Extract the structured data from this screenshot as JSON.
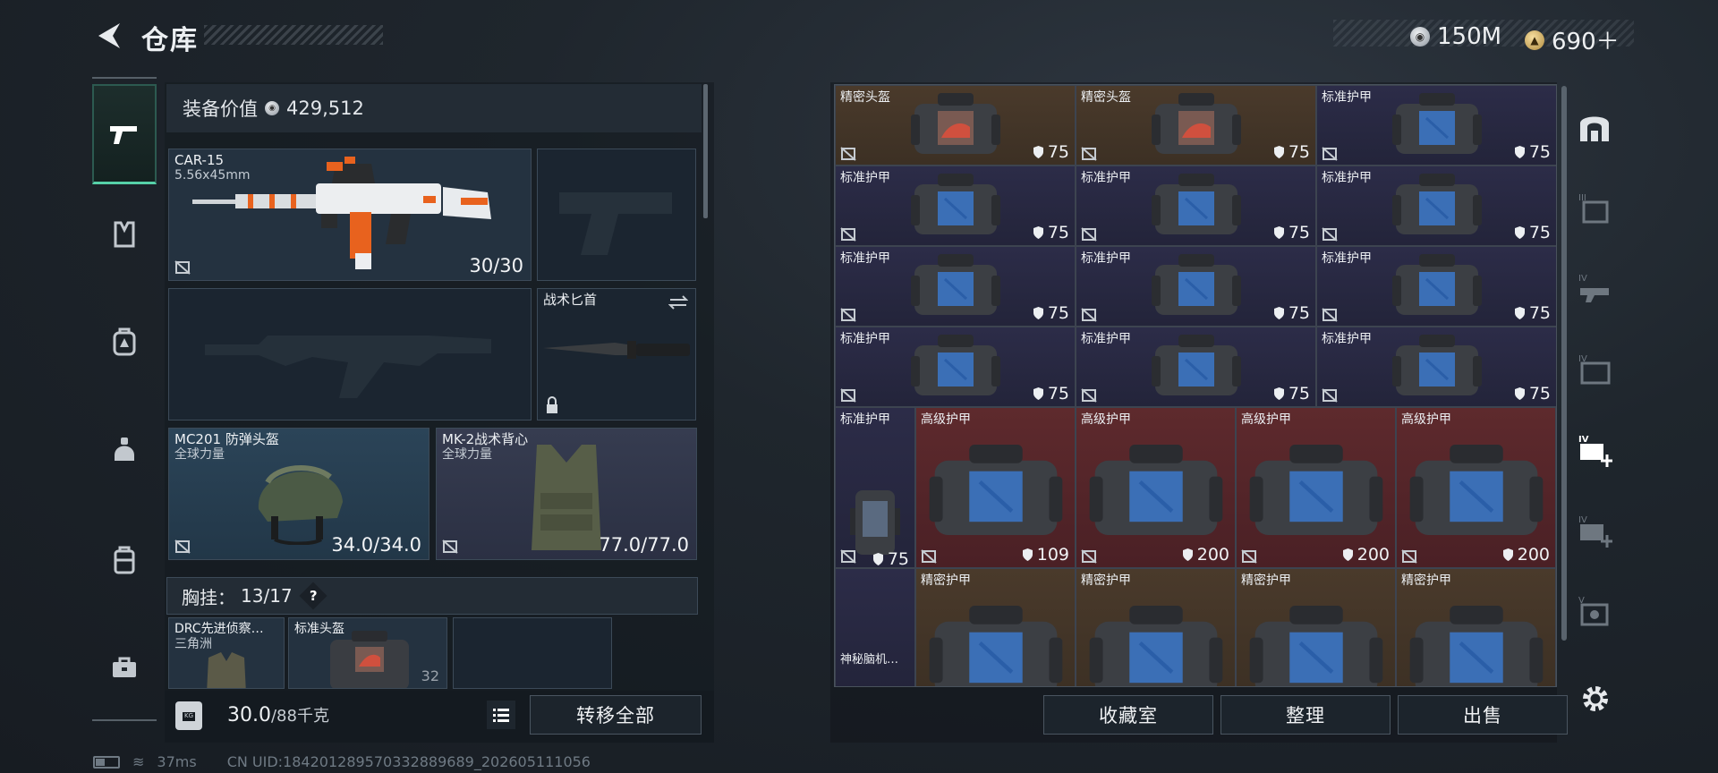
{
  "header": {
    "title": "仓库",
    "currency": [
      {
        "icon": "silver-coin-icon",
        "value": "150M"
      },
      {
        "icon": "gold-coin-icon",
        "value": "690＋"
      }
    ]
  },
  "left_nav": {
    "items": [
      "pistol-icon",
      "armor-vest-icon",
      "backpack-icon",
      "helmet-icon",
      "chest-rig-icon",
      "toolbox-icon"
    ],
    "active": 0
  },
  "equipment": {
    "value_label": "装备价值",
    "value": "429,512",
    "primary": {
      "name": "CAR-15",
      "caliber": "5.56x45mm",
      "ammo": "30/30"
    },
    "melee": {
      "name": "战术匕首"
    },
    "helmet": {
      "name": "MC201 防弹头盔",
      "sub": "全球力量",
      "durability": "34.0/34.0"
    },
    "vest": {
      "name": "MK-2战术背心",
      "sub": "全球力量",
      "durability": "77.0/77.0"
    },
    "chest_rig": {
      "label": "胸挂：",
      "capacity": "13/17",
      "help": "?"
    },
    "rig_items": [
      {
        "name": "DRC先进侦察…",
        "sub": "三角洲"
      },
      {
        "name": "标准头盔",
        "val": "32"
      }
    ]
  },
  "bottom_left": {
    "weight": "30.0",
    "weight_max": "/88千克",
    "transfer_all": "转移全部"
  },
  "status_bar": {
    "ping": "37ms",
    "uid": "CN UID:1842012895703328896​89_202605111056"
  },
  "stash": {
    "rows": [
      [
        {
          "name": "精密头盔",
          "val": "75",
          "color": "gold"
        },
        {
          "name": "精密头盔",
          "val": "75",
          "color": "gold"
        },
        {
          "name": "标准护甲",
          "val": "75",
          "color": "blue"
        }
      ],
      [
        {
          "name": "标准护甲",
          "val": "75",
          "color": "blue"
        },
        {
          "name": "标准护甲",
          "val": "75",
          "color": "blue"
        },
        {
          "name": "标准护甲",
          "val": "75",
          "color": "blue"
        }
      ],
      [
        {
          "name": "标准护甲",
          "val": "75",
          "color": "blue"
        },
        {
          "name": "标准护甲",
          "val": "75",
          "color": "blue"
        },
        {
          "name": "标准护甲",
          "val": "75",
          "color": "blue"
        }
      ],
      [
        {
          "name": "标准护甲",
          "val": "75",
          "color": "blue"
        },
        {
          "name": "标准护甲",
          "val": "75",
          "color": "blue"
        },
        {
          "name": "标准护甲",
          "val": "75",
          "color": "blue"
        }
      ]
    ],
    "tall_item": {
      "name": "标准护甲",
      "val": "75"
    },
    "red_items": [
      {
        "name": "高级护甲",
        "val": "109"
      },
      {
        "name": "高级护甲",
        "val": "200"
      },
      {
        "name": "高级护甲",
        "val": "200"
      },
      {
        "name": "高级护甲",
        "val": "200"
      }
    ],
    "gold_items": [
      {
        "name": "精密护甲"
      },
      {
        "name": "精密护甲"
      },
      {
        "name": "精密护甲"
      },
      {
        "name": "精密护甲"
      }
    ],
    "small_item": {
      "name": "神秘脑机…"
    },
    "buttons": {
      "collection": "收藏室",
      "sort": "整理",
      "sell": "出售"
    }
  },
  "right_nav": [
    "arch-icon",
    "tier-III-icon",
    "tier-IV-icon",
    "tier-IV-folder-icon",
    "tier-IV-plus-icon",
    "tier-IV-plus2-icon",
    "tier-V-icon"
  ]
}
